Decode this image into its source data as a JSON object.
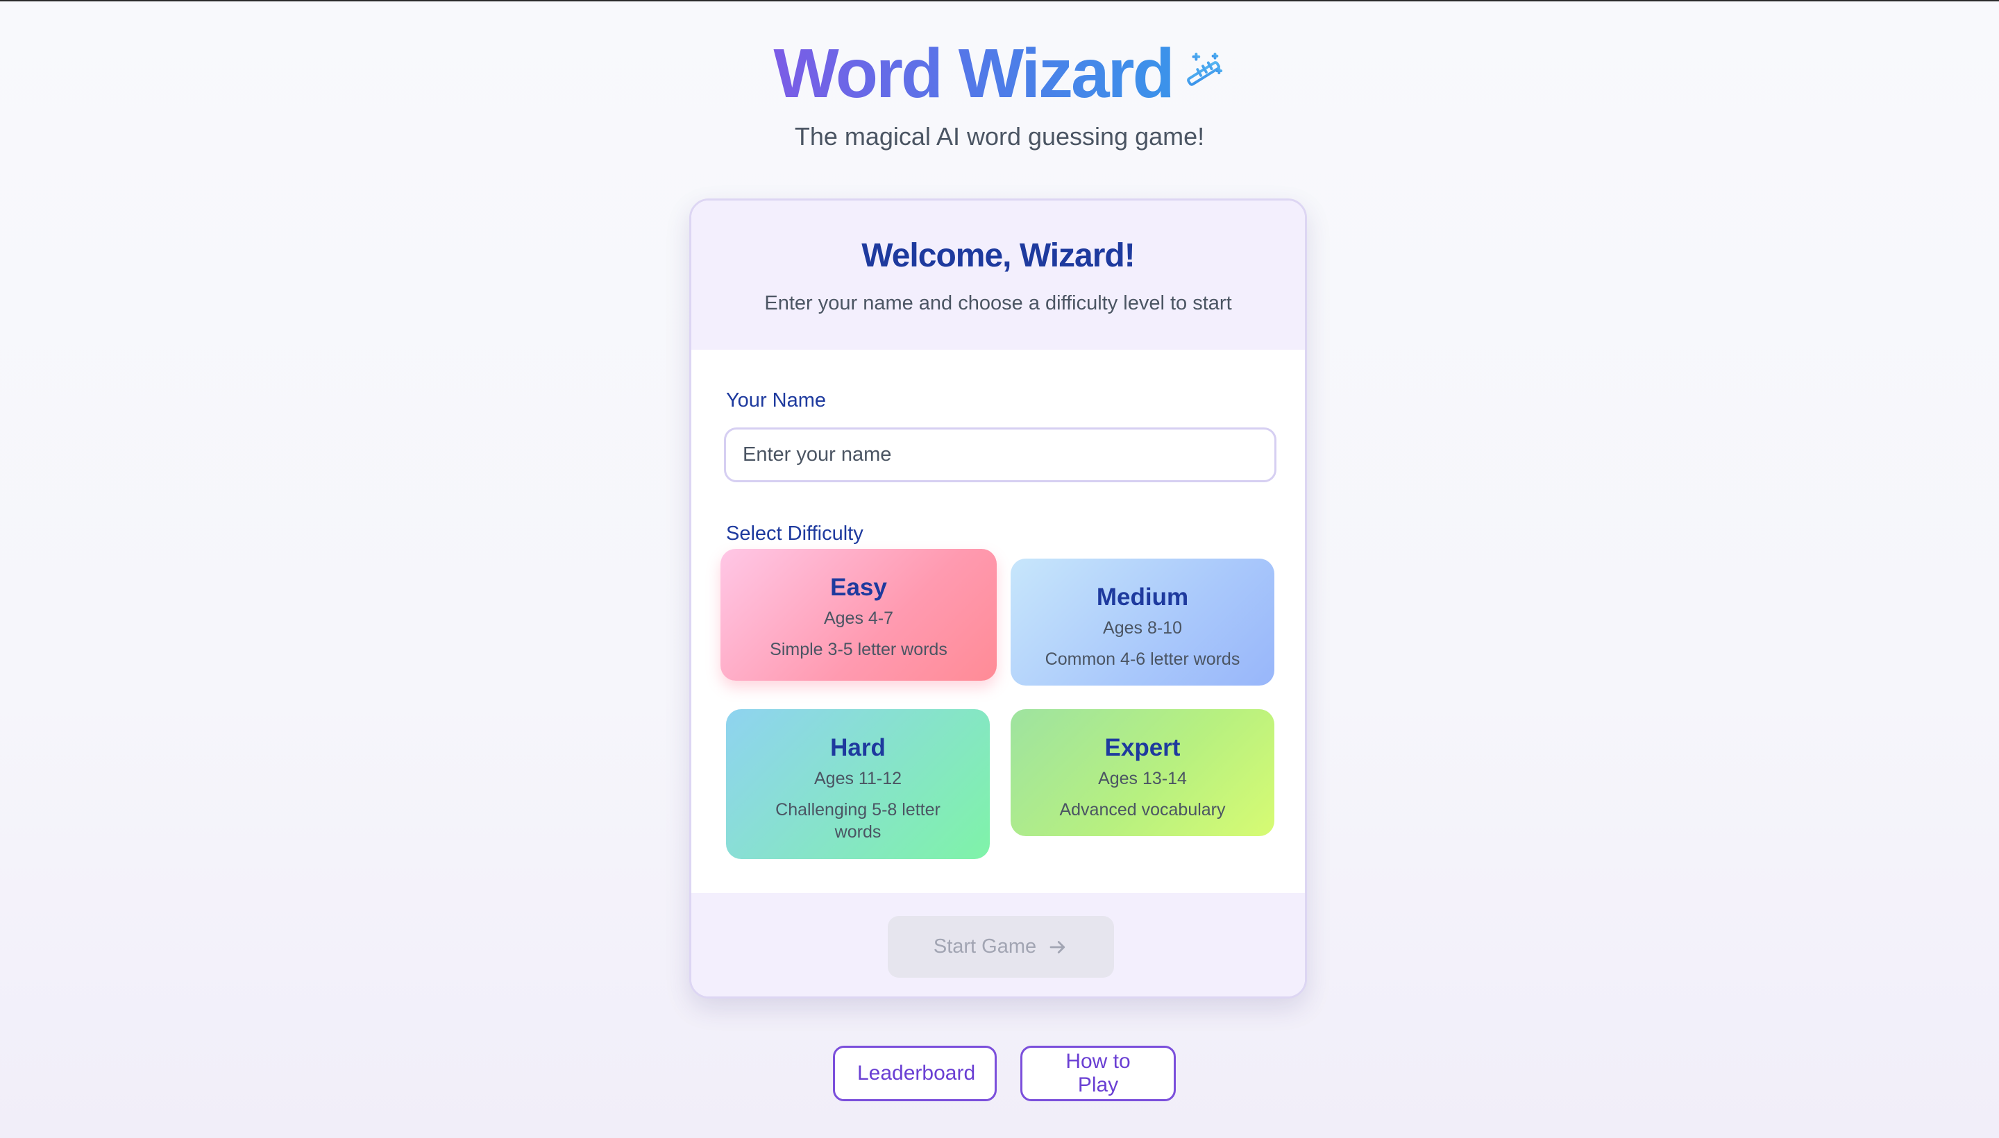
{
  "app": {
    "title": "Word Wizard",
    "subtitle": "The magical AI word guessing game!",
    "icon": "magic-wand-icon"
  },
  "welcome_card": {
    "title": "Welcome, Wizard!",
    "subtitle": "Enter your name and choose a difficulty level to start",
    "name_label": "Your Name",
    "name_input": {
      "value": "",
      "placeholder": "Enter your name"
    },
    "difficulty_label": "Select Difficulty",
    "difficulties": [
      {
        "name": "Easy",
        "ages": "Ages 4-7",
        "description": "Simple 3-5 letter words",
        "selected": true
      },
      {
        "name": "Medium",
        "ages": "Ages 8-10",
        "description": "Common 4-6 letter words",
        "selected": false
      },
      {
        "name": "Hard",
        "ages": "Ages 11-12",
        "description": "Challenging 5-8 letter words",
        "selected": false
      },
      {
        "name": "Expert",
        "ages": "Ages 13-14",
        "description": "Advanced vocabulary",
        "selected": false
      }
    ],
    "start_button": {
      "label": "Start Game",
      "icon": "arrow-right-icon",
      "disabled": true
    }
  },
  "footer_links": {
    "leaderboard": "Leaderboard",
    "how_to_play": "How to Play"
  },
  "colors": {
    "title_gradient_start": "#7b5ce6",
    "title_gradient_end": "#3b93ea",
    "heading_blue": "#1e3a9e",
    "accent_purple": "#6a3fd3",
    "card_header_bg": "#f3effd"
  }
}
